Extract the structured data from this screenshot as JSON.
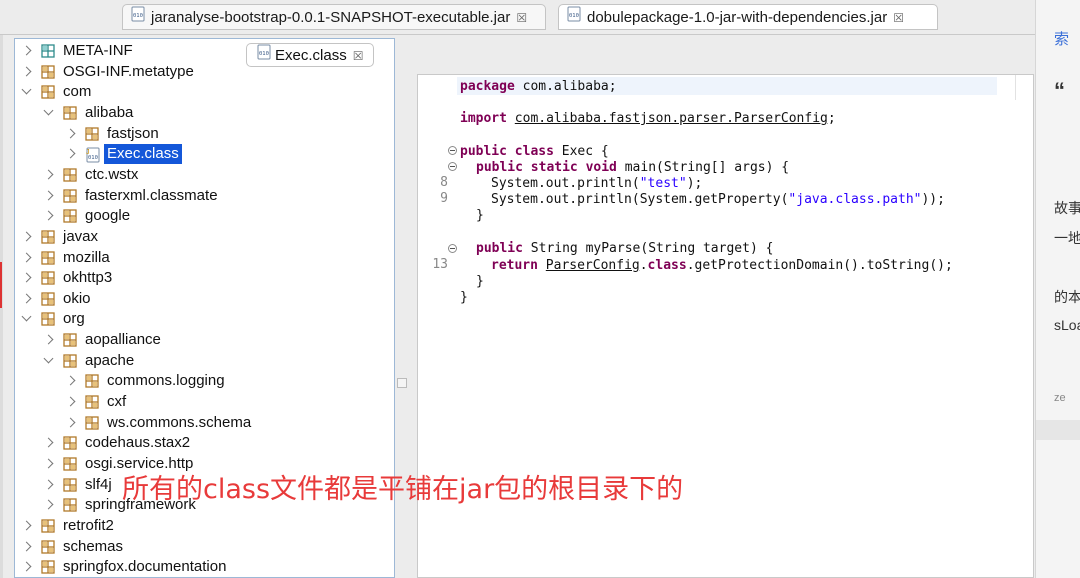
{
  "window_tabs": [
    {
      "label": "jaranalyse-bootstrap-0.0.1-SNAPSHOT-executable.jar",
      "close": "☒"
    },
    {
      "label": "dobulepackage-1.0-jar-with-dependencies.jar",
      "close": "☒"
    }
  ],
  "tree": {
    "items": [
      {
        "label": "META-INF",
        "indent": 0,
        "state": "collapsed",
        "icon": "folder-icon"
      },
      {
        "label": "OSGI-INF.metatype",
        "indent": 0,
        "state": "collapsed",
        "icon": "package-icon"
      },
      {
        "label": "com",
        "indent": 0,
        "state": "expanded",
        "icon": "package-icon"
      },
      {
        "label": "alibaba",
        "indent": 1,
        "state": "expanded",
        "icon": "package-icon"
      },
      {
        "label": "fastjson",
        "indent": 2,
        "state": "collapsed",
        "icon": "package-icon"
      },
      {
        "label": "Exec.class",
        "indent": 2,
        "state": "collapsed",
        "icon": "class-file-icon",
        "selected": true
      },
      {
        "label": "ctc.wstx",
        "indent": 1,
        "state": "collapsed",
        "icon": "package-icon"
      },
      {
        "label": "fasterxml.classmate",
        "indent": 1,
        "state": "collapsed",
        "icon": "package-icon"
      },
      {
        "label": "google",
        "indent": 1,
        "state": "collapsed",
        "icon": "package-icon"
      },
      {
        "label": "javax",
        "indent": 0,
        "state": "collapsed",
        "icon": "package-icon"
      },
      {
        "label": "mozilla",
        "indent": 0,
        "state": "collapsed",
        "icon": "package-icon"
      },
      {
        "label": "okhttp3",
        "indent": 0,
        "state": "collapsed",
        "icon": "package-icon"
      },
      {
        "label": "okio",
        "indent": 0,
        "state": "collapsed",
        "icon": "package-icon"
      },
      {
        "label": "org",
        "indent": 0,
        "state": "expanded",
        "icon": "package-icon"
      },
      {
        "label": "aopalliance",
        "indent": 1,
        "state": "collapsed",
        "icon": "package-icon"
      },
      {
        "label": "apache",
        "indent": 1,
        "state": "expanded",
        "icon": "package-icon"
      },
      {
        "label": "commons.logging",
        "indent": 2,
        "state": "collapsed",
        "icon": "package-icon"
      },
      {
        "label": "cxf",
        "indent": 2,
        "state": "collapsed",
        "icon": "package-icon"
      },
      {
        "label": "ws.commons.schema",
        "indent": 2,
        "state": "collapsed",
        "icon": "package-icon"
      },
      {
        "label": "codehaus.stax2",
        "indent": 1,
        "state": "collapsed",
        "icon": "package-icon"
      },
      {
        "label": "osgi.service.http",
        "indent": 1,
        "state": "collapsed",
        "icon": "package-icon"
      },
      {
        "label": "slf4j",
        "indent": 1,
        "state": "collapsed",
        "icon": "package-icon"
      },
      {
        "label": "springframework",
        "indent": 1,
        "state": "collapsed",
        "icon": "package-icon"
      },
      {
        "label": "retrofit2",
        "indent": 0,
        "state": "collapsed",
        "icon": "package-icon"
      },
      {
        "label": "schemas",
        "indent": 0,
        "state": "collapsed",
        "icon": "package-icon"
      },
      {
        "label": "springfox.documentation",
        "indent": 0,
        "state": "collapsed",
        "icon": "package-icon"
      }
    ]
  },
  "editor": {
    "tab_label": "Exec.class",
    "tab_close": "☒",
    "line_numbers": [
      "8",
      "9",
      "13"
    ],
    "code": {
      "package_kw": "package",
      "package_name": " com.alibaba;",
      "import_kw": "import",
      "import_name": "com.alibaba.fastjson.parser.ParserConfig",
      "import_end": ";",
      "class_kw": "public class",
      "class_name": " Exec {",
      "main_kw": "public static void",
      "main_sig": " main(String[] args) {",
      "l1_pre": "System.out.println(",
      "l1_str": "\"test\"",
      "l1_end": ");",
      "l2_pre": "System.out.println(System.getProperty(",
      "l2_str": "\"java.class.path\"",
      "l2_end": "));",
      "close1": "}",
      "parse_kw": "public",
      "parse_sig": " String myParse(String target) {",
      "return_kw": "return",
      "return_cls": "ParserConfig",
      "return_dot": ".",
      "return_kw2": "class",
      "return_end": ".getProtectionDomain().toString();",
      "close2": "}",
      "close3": "}"
    }
  },
  "background_page": {
    "texts": [
      "索",
      "“",
      "故事",
      "一地",
      "的本",
      "sLoa",
      "ze"
    ]
  },
  "annotation": "所有的class文件都是平铺在jar包的根目录下的",
  "colors": {
    "selection": "#1457d9",
    "keyword": "#7f0055",
    "string": "#2a00ff",
    "annotation": "#e83a3a",
    "package_icon": "#b07a2a",
    "folder_icon": "#2e8b8b"
  }
}
